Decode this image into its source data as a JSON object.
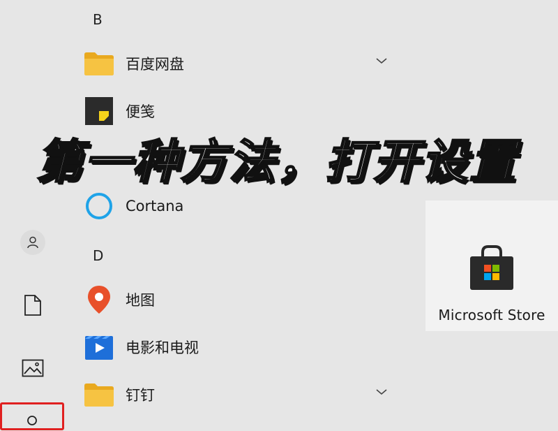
{
  "start_menu": {
    "sections": [
      {
        "letter": "B"
      },
      {
        "letter": "D"
      }
    ],
    "apps": [
      {
        "label": "百度网盘",
        "icon": "folder-icon",
        "has_chevron": true
      },
      {
        "label": "便笺",
        "icon": "sticky-notes-icon"
      },
      {
        "label": "Cortana",
        "icon": "cortana-ring-icon"
      },
      {
        "label": "地图",
        "icon": "map-pin-icon"
      },
      {
        "label": "电影和电视",
        "icon": "movies-tv-icon"
      },
      {
        "label": "钉钉",
        "icon": "folder-icon",
        "has_chevron": true
      }
    ],
    "tile": {
      "label": "Microsoft Store",
      "icon": "store-bag-icon"
    }
  },
  "rail": {
    "items": [
      {
        "name": "user-icon"
      },
      {
        "name": "documents-icon"
      },
      {
        "name": "pictures-icon"
      },
      {
        "name": "settings-icon",
        "highlighted": true
      }
    ]
  },
  "overlay": {
    "caption": "第一种方法，打开设置"
  },
  "colors": {
    "background": "#e6e6e6",
    "tile_bg": "#f2f2f2",
    "highlight": "#e02020",
    "folder": "#f6c342",
    "cortana": "#1fa3e8",
    "map_pin": "#e8502a",
    "movies": "#1e6fd9"
  }
}
